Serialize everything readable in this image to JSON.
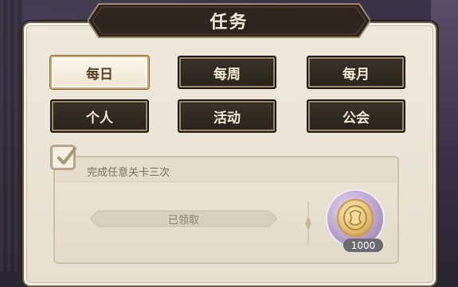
{
  "title": "任务",
  "tabs": [
    {
      "label": "每日",
      "active": true
    },
    {
      "label": "每周",
      "active": false
    },
    {
      "label": "每月",
      "active": false
    },
    {
      "label": "个人",
      "active": false
    },
    {
      "label": "活动",
      "active": false
    },
    {
      "label": "公会",
      "active": false
    }
  ],
  "quest": {
    "title": "完成任意关卡三次",
    "status": "已领取",
    "completed": true,
    "reward": {
      "icon": "gold-coin-icon",
      "amount": "1000"
    }
  },
  "colors": {
    "panel_bg": "#efe9dc",
    "tab_dark": "#2e261e",
    "tab_active": "#f7f0e0",
    "banner": "#332a22"
  }
}
